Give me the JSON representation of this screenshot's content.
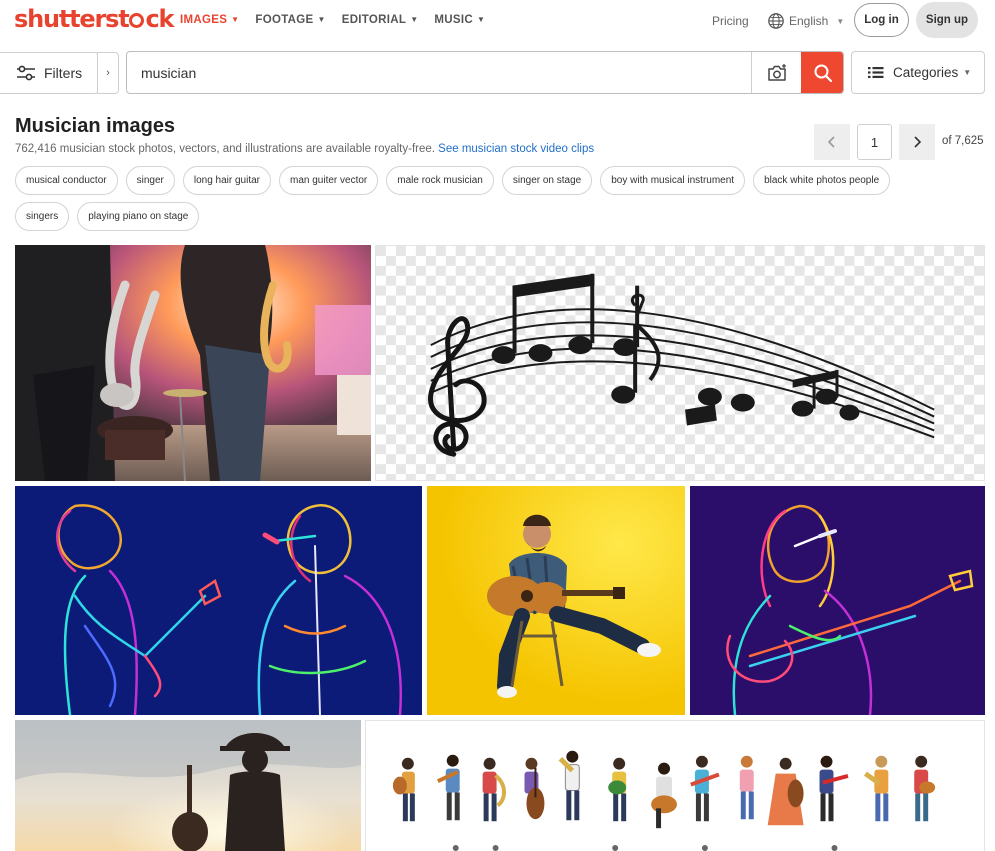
{
  "colors": {
    "brand": "#e8432e",
    "search_button": "#ef4830",
    "link": "#1f6fc9"
  },
  "header": {
    "logo": {
      "before": "shutterst",
      "after": "ck"
    },
    "nav": [
      {
        "label": "IMAGES",
        "active": true
      },
      {
        "label": "FOOTAGE",
        "active": false
      },
      {
        "label": "EDITORIAL",
        "active": false
      },
      {
        "label": "MUSIC",
        "active": false
      }
    ],
    "pricing": "Pricing",
    "language": "English",
    "login": "Log in",
    "signup": "Sign up"
  },
  "search": {
    "filters_label": "Filters",
    "query": "musician",
    "categories_label": "Categories"
  },
  "results": {
    "title": "Musician images",
    "summary": "762,416 musician stock photos, vectors, and illustrations are available royalty-free.",
    "video_link": "See musician stock video clips",
    "page": "1",
    "total_pages": "of 7,625"
  },
  "chips": [
    "musical conductor",
    "singer",
    "long hair guitar",
    "man guiter vector",
    "male rock musician",
    "singer on stage",
    "boy with musical instrument",
    "black white photos people",
    "singers",
    "playing piano on stage"
  ],
  "icons": {
    "filters": "sliders-icon",
    "search": "magnifier-icon",
    "camera": "camera-search-icon",
    "categories": "list-icon",
    "language": "globe-icon",
    "prev": "chevron-left-icon",
    "next": "chevron-right-icon"
  }
}
